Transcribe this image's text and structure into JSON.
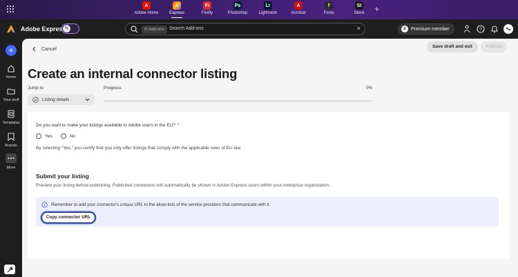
{
  "app_switcher": {
    "apps": [
      {
        "label": "Adobe Home",
        "glyph": "A",
        "color": "#eb1000",
        "active": false
      },
      {
        "label": "Express",
        "glyph": "A",
        "color": "#1e1e1e",
        "active": true
      },
      {
        "label": "Firefly",
        "glyph": "Fi",
        "color": "#e0282d",
        "active": false
      },
      {
        "label": "Photoshop",
        "glyph": "Ps",
        "color": "#001e36",
        "active": false
      },
      {
        "label": "Lightroom",
        "glyph": "Lr",
        "color": "#001a36",
        "active": false
      },
      {
        "label": "Acrobat",
        "glyph": "A",
        "color": "#cc0f0f",
        "active": false
      },
      {
        "label": "Fonts",
        "glyph": "f",
        "color": "#2b2b2b",
        "active": false
      },
      {
        "label": "Stock",
        "glyph": "St",
        "color": "#1a1a1a",
        "active": false
      }
    ],
    "add_label": "+"
  },
  "header": {
    "brand": "Adobe Express",
    "search_scope": "In Add-ons",
    "search_placeholder": "Search Add-ons",
    "premium_label": "Premium member"
  },
  "rail": {
    "items": [
      {
        "label": "Home",
        "icon": "home-icon"
      },
      {
        "label": "Your stuff",
        "icon": "folder-icon"
      },
      {
        "label": "Templates",
        "icon": "templates-icon"
      },
      {
        "label": "Brands",
        "icon": "brands-icon"
      },
      {
        "label": "More",
        "icon": "more-icon"
      }
    ]
  },
  "toolbar": {
    "cancel_label": "Cancel",
    "save_label": "Save draft and exit",
    "publish_label": "Publish"
  },
  "page": {
    "title": "Create an internal connector listing",
    "jump_label": "Jump to",
    "jump_value": "Listing details",
    "progress_label": "Progress",
    "progress_value": "0%",
    "progress_fraction": 0
  },
  "eu_section": {
    "question": "Do you want to make your listings available to Adobe users in the EU?",
    "required_mark": "*",
    "yes_label": "Yes",
    "no_label": "No",
    "certify_text": "By selecting \"Yes,\" you certify that you only offer listings that comply with the applicable rules of EU law."
  },
  "submit_section": {
    "title": "Submit your listing",
    "description": "Preview your listing before publishing. Published connectors will automatically be shown in Adobe Express users within your enterprise organization.",
    "info_text": "Remember to add your connector's unique URL to the allow-lists of the service providers that communicate with it.",
    "copy_button_label": "Copy connector URL"
  },
  "colors": {
    "accent": "#4069fd",
    "appbar": "#3b1f6b",
    "info_bg": "#eceefb"
  }
}
